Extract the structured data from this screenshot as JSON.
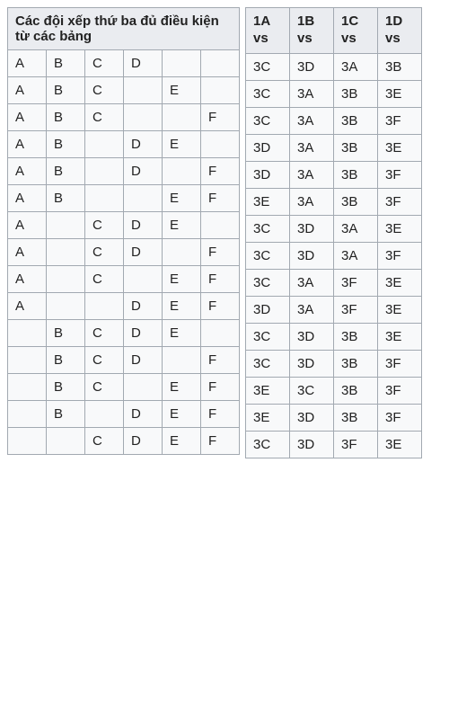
{
  "left": {
    "header": "Các đội xếp thứ ba đủ điều kiện từ các bảng",
    "rows": [
      [
        "A",
        "B",
        "C",
        "D",
        "",
        ""
      ],
      [
        "A",
        "B",
        "C",
        "",
        "E",
        ""
      ],
      [
        "A",
        "B",
        "C",
        "",
        "",
        "F"
      ],
      [
        "A",
        "B",
        "",
        "D",
        "E",
        ""
      ],
      [
        "A",
        "B",
        "",
        "D",
        "",
        "F"
      ],
      [
        "A",
        "B",
        "",
        "",
        "E",
        "F"
      ],
      [
        "A",
        "",
        "C",
        "D",
        "E",
        ""
      ],
      [
        "A",
        "",
        "C",
        "D",
        "",
        "F"
      ],
      [
        "A",
        "",
        "C",
        "",
        "E",
        "F"
      ],
      [
        "A",
        "",
        "",
        "D",
        "E",
        "F"
      ],
      [
        "",
        "B",
        "C",
        "D",
        "E",
        ""
      ],
      [
        "",
        "B",
        "C",
        "D",
        "",
        "F"
      ],
      [
        "",
        "B",
        "C",
        "",
        "E",
        "F"
      ],
      [
        "",
        "B",
        "",
        "D",
        "E",
        "F"
      ],
      [
        "",
        "",
        "C",
        "D",
        "E",
        "F"
      ]
    ]
  },
  "right": {
    "headers": [
      {
        "top": "1A",
        "bottom": "vs"
      },
      {
        "top": "1B",
        "bottom": "vs"
      },
      {
        "top": "1C",
        "bottom": "vs"
      },
      {
        "top": "1D",
        "bottom": "vs"
      }
    ],
    "rows": [
      [
        "3C",
        "3D",
        "3A",
        "3B"
      ],
      [
        "3C",
        "3A",
        "3B",
        "3E"
      ],
      [
        "3C",
        "3A",
        "3B",
        "3F"
      ],
      [
        "3D",
        "3A",
        "3B",
        "3E"
      ],
      [
        "3D",
        "3A",
        "3B",
        "3F"
      ],
      [
        "3E",
        "3A",
        "3B",
        "3F"
      ],
      [
        "3C",
        "3D",
        "3A",
        "3E"
      ],
      [
        "3C",
        "3D",
        "3A",
        "3F"
      ],
      [
        "3C",
        "3A",
        "3F",
        "3E"
      ],
      [
        "3D",
        "3A",
        "3F",
        "3E"
      ],
      [
        "3C",
        "3D",
        "3B",
        "3E"
      ],
      [
        "3C",
        "3D",
        "3B",
        "3F"
      ],
      [
        "3E",
        "3C",
        "3B",
        "3F"
      ],
      [
        "3E",
        "3D",
        "3B",
        "3F"
      ],
      [
        "3C",
        "3D",
        "3F",
        "3E"
      ]
    ]
  }
}
